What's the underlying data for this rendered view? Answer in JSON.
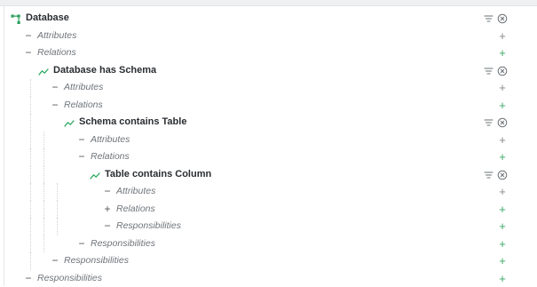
{
  "colors": {
    "add_plus": "#3aa864",
    "relation_icon": "#2ba860",
    "database_icon": "#2a9d5c",
    "muted_text": "#6f747a"
  },
  "icons": {
    "database": "database-tree-icon",
    "relation": "relation-line-icon",
    "filter": "filter-icon",
    "remove": "remove-circle-icon",
    "add": "plus-icon"
  },
  "tree": [
    {
      "depth": 0,
      "type": "node",
      "icon": "database",
      "label": "Database"
    },
    {
      "depth": 1,
      "type": "section",
      "toggle": "−",
      "label": "Attributes",
      "plus_color": "#888888"
    },
    {
      "depth": 1,
      "type": "section",
      "toggle": "−",
      "label": "Relations",
      "plus_color": "#3aa864"
    },
    {
      "depth": 2,
      "type": "node",
      "icon": "relation",
      "label": "Database has Schema"
    },
    {
      "depth": 3,
      "type": "section",
      "toggle": "−",
      "label": "Attributes",
      "plus_color": "#888888"
    },
    {
      "depth": 3,
      "type": "section",
      "toggle": "−",
      "label": "Relations",
      "plus_color": "#3aa864"
    },
    {
      "depth": 4,
      "type": "node",
      "icon": "relation",
      "label": "Schema contains Table"
    },
    {
      "depth": 5,
      "type": "section",
      "toggle": "−",
      "label": "Attributes",
      "plus_color": "#888888"
    },
    {
      "depth": 5,
      "type": "section",
      "toggle": "−",
      "label": "Relations",
      "plus_color": "#3aa864"
    },
    {
      "depth": 6,
      "type": "node",
      "icon": "relation",
      "label": "Table contains Column"
    },
    {
      "depth": 7,
      "type": "section",
      "toggle": "−",
      "label": "Attributes",
      "plus_color": "#888888"
    },
    {
      "depth": 7,
      "type": "section",
      "toggle": "+",
      "label": "Relations",
      "plus_color": "#3aa864"
    },
    {
      "depth": 7,
      "type": "section",
      "toggle": "−",
      "label": "Responsibilities",
      "plus_color": "#3aa864"
    },
    {
      "depth": 5,
      "type": "section",
      "toggle": "−",
      "label": "Responsibilities",
      "plus_color": "#3aa864"
    },
    {
      "depth": 3,
      "type": "section",
      "toggle": "−",
      "label": "Responsibilities",
      "plus_color": "#3aa864"
    },
    {
      "depth": 1,
      "type": "section",
      "toggle": "−",
      "label": "Responsibilities",
      "plus_color": "#3aa864"
    }
  ]
}
